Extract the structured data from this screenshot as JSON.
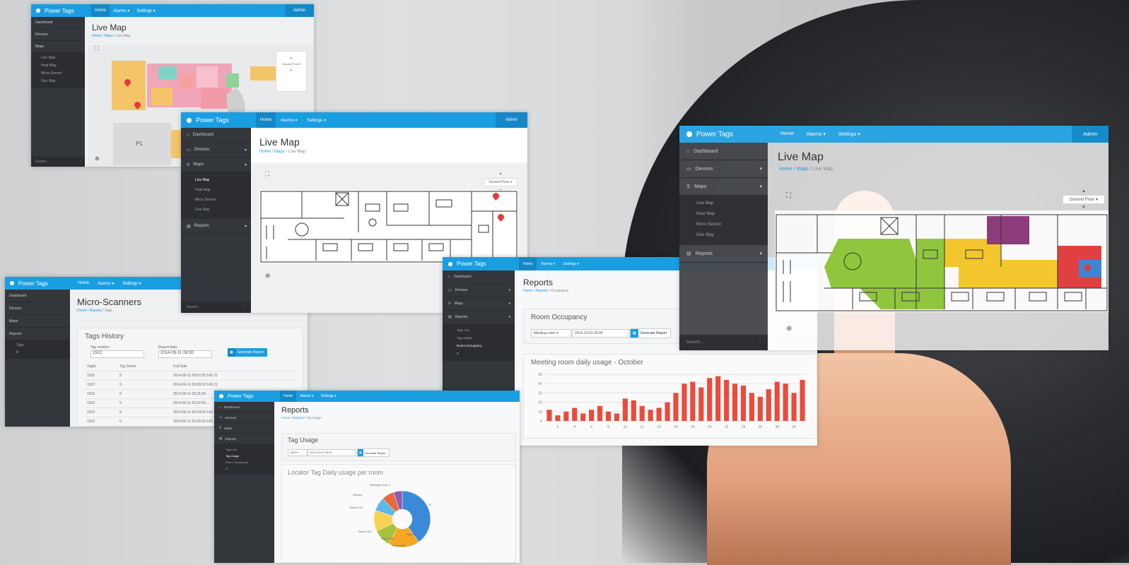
{
  "brand": "Power Tags",
  "nav": {
    "home": "Home",
    "alarms": "Alarms ▾",
    "settings": "Settings ▾",
    "admin": "Admin"
  },
  "sidebar": {
    "dashboard": "Dashboard",
    "devices": "Devices",
    "maps": "Maps",
    "reports": "Reports",
    "map_items": [
      "Live Map",
      "Heat Map",
      "Micro Sensor",
      "Geo Way"
    ],
    "report_items": [
      "Tags List",
      "Tag Usage",
      "Room Occupancy",
      "R"
    ],
    "tag_items": [
      "Tags",
      "R"
    ],
    "search": "Search..."
  },
  "livemap": {
    "title": "Live Map",
    "crumbs": [
      "Home",
      "Maps",
      "Live Map"
    ],
    "floor": "Ground Floor",
    "floor_label": "Ground Floor ▾",
    "parking": "P1"
  },
  "micro": {
    "title": "Micro-Scanners",
    "crumbs": [
      "Home",
      "Reports",
      "Tags"
    ],
    "panel_title": "Tags History",
    "tag_number_label": "Tag number:",
    "tag_number_value": "1522",
    "report_date_label": "Report date:",
    "report_date_value": "2014-09-11 08:30",
    "generate": "Generate Report",
    "columns": [
      "TagId",
      "Tag Sector",
      "Full Date"
    ],
    "rows": [
      [
        "1522",
        "5",
        "2014-09-11 00:07:02:142.21"
      ],
      [
        "1522",
        "5",
        "2014-09-11 00:08:02:143.21"
      ],
      [
        "1522",
        "6",
        "2014-09-11 00:31:02:..."
      ],
      [
        "1522",
        "5",
        "2014-09-11 00:32:02:..."
      ],
      [
        "1522",
        "5",
        "2014-09-11 00:34:02:142.21"
      ],
      [
        "1522",
        "6",
        "2014-09-11 00:35:02:142.21"
      ]
    ]
  },
  "occupancy": {
    "title": "Reports",
    "crumbs": [
      "Home",
      "Reports",
      "Occupancy"
    ],
    "panel_title": "Room Occupancy",
    "select": "Meeting room ▾",
    "date": "2014-10-01 00:00",
    "generate": "Generate Report",
    "chart_title": "Meeting room daily usage - October"
  },
  "tagusage": {
    "title": "Reports",
    "crumbs": [
      "Home",
      "Reports",
      "Tag Usage"
    ],
    "panel_title": "Tag Usage",
    "select": "1522 ▾",
    "date": "2014-10-01 00:00",
    "generate": "Generate Report",
    "chart_title": "Locator Tag Daily usage per room",
    "labels": [
      "Meeting Room 1",
      "Kitchen",
      "Room 101",
      "Room 200",
      "Room 201",
      "Room 202",
      "Room 203",
      "R"
    ]
  },
  "chart_data": [
    {
      "type": "bar",
      "title": "Meeting room daily usage - October",
      "categories": [
        "1",
        "2",
        "3",
        "4",
        "5",
        "6",
        "7",
        "8",
        "9",
        "10",
        "11",
        "12",
        "13",
        "14",
        "15",
        "16",
        "17",
        "18",
        "19",
        "20",
        "21",
        "22",
        "23",
        "24",
        "25",
        "26",
        "27",
        "28",
        "29",
        "30",
        "31"
      ],
      "values": [
        12,
        6,
        10,
        14,
        8,
        12,
        16,
        10,
        8,
        24,
        22,
        16,
        12,
        14,
        20,
        30,
        40,
        42,
        36,
        46,
        48,
        44,
        40,
        38,
        30,
        26,
        34,
        42,
        40,
        30,
        44
      ],
      "ylim": [
        0,
        50
      ],
      "yticks": [
        "50",
        "40",
        "30",
        "20",
        "10",
        "0"
      ],
      "xticks": [
        "2",
        "4",
        "6",
        "8",
        "10",
        "12",
        "14",
        "16",
        "18",
        "20",
        "22",
        "24",
        "26",
        "28",
        "30"
      ],
      "color": "#e84c3d",
      "grid": true
    },
    {
      "type": "pie",
      "title": "Locator Tag Daily usage per room",
      "labels": [
        "Room 101",
        "Meeting Room 1",
        "Kitchen",
        "Room 200",
        "Room 201",
        "Room 202",
        "Room 203"
      ],
      "values": [
        40,
        18,
        10,
        12,
        8,
        7,
        5
      ],
      "colors": [
        "#3b8ad8",
        "#f5a623",
        "#a6c23a",
        "#f7d154",
        "#5fb8e8",
        "#e86a3a",
        "#8e5bb5"
      ]
    }
  ],
  "colors": {
    "accent": "#1a9ee2",
    "sidebar": "#33363b",
    "bar": "#e84c3d"
  }
}
